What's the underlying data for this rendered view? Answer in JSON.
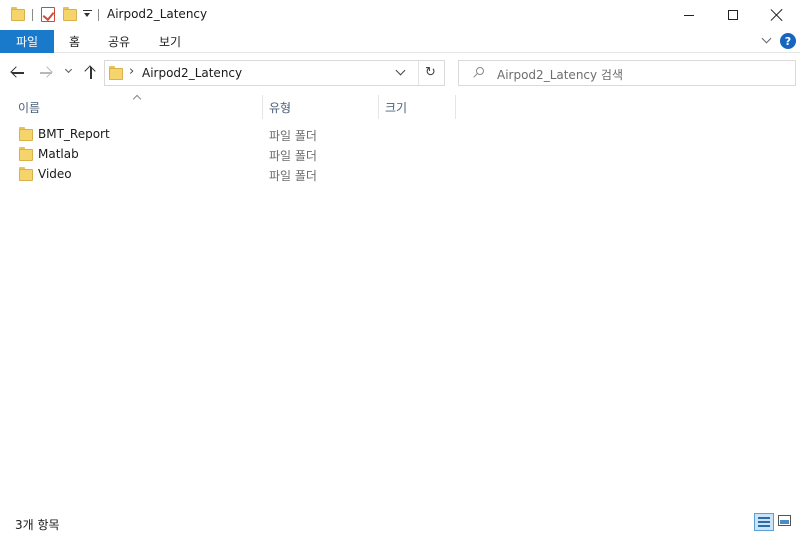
{
  "window": {
    "title": "Airpod2_Latency"
  },
  "ribbon": {
    "tabs": [
      {
        "label": "파일"
      },
      {
        "label": "홈"
      },
      {
        "label": "공유"
      },
      {
        "label": "보기"
      }
    ],
    "help_label": "?"
  },
  "navigation": {
    "address_separator": "›",
    "address_path": "Airpod2_Latency",
    "search_placeholder": "Airpod2_Latency 검색"
  },
  "columns": [
    {
      "label": "이름"
    },
    {
      "label": "유형"
    },
    {
      "label": "크기"
    }
  ],
  "files": [
    {
      "name": "BMT_Report",
      "type": "파일 폴더",
      "icon": "folder-icon"
    },
    {
      "name": "Matlab",
      "type": "파일 폴더",
      "icon": "folder-icon"
    },
    {
      "name": "Video",
      "type": "파일 폴더",
      "icon": "folder-icon"
    }
  ],
  "status": {
    "item_count": "3개 항목"
  },
  "colors": {
    "file_tab": "#1979ca",
    "folder": "#f6d46c",
    "header_text": "#4c607a",
    "help": "#1666c0"
  }
}
